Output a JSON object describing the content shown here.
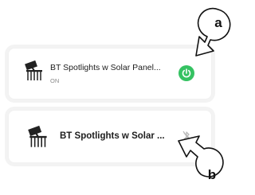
{
  "devices": [
    {
      "name": "BT Spotlights w Solar Panel...",
      "status": "ON",
      "icon": "spotlight-solar-icon",
      "control": "power-button",
      "control_color": "#35c262"
    },
    {
      "name": "BT Spotlights w Solar ...",
      "icon": "spotlight-solar-icon",
      "control": "bluetooth-off-icon"
    }
  ],
  "callouts": {
    "a": "a",
    "b": "b"
  },
  "colors": {
    "accent_green": "#35c262",
    "card_border": "#f1f1f1",
    "text_primary": "#1d1d1d",
    "text_secondary": "#8a8a8a"
  }
}
